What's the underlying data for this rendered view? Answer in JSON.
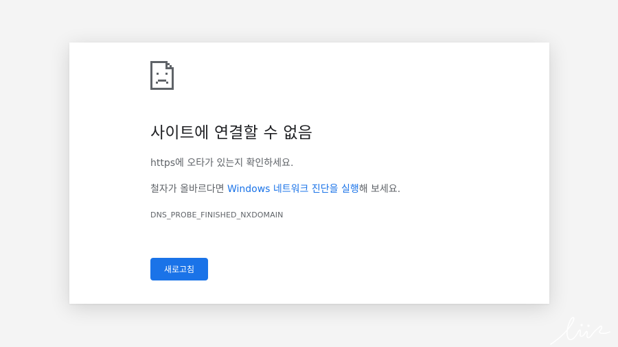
{
  "error_page": {
    "icon": "sad-page-icon",
    "title": "사이트에 연결할 수 없음",
    "typo_message": "https에 오타가 있는지 확인하세요.",
    "diagnostics": {
      "prefix": "철자가 올바르다면 ",
      "link_label": "Windows 네트워크 진단을 실행",
      "suffix": "해 보세요."
    },
    "error_code": "DNS_PROBE_FINISHED_NXDOMAIN",
    "reload_button_label": "새로고침"
  },
  "colors": {
    "accent": "#1a73e8",
    "title_text": "#202124",
    "body_text": "#5f6368",
    "card_background": "#ffffff",
    "page_background": "#f4f4f4"
  },
  "watermark": {
    "type": "handwritten-signature"
  }
}
